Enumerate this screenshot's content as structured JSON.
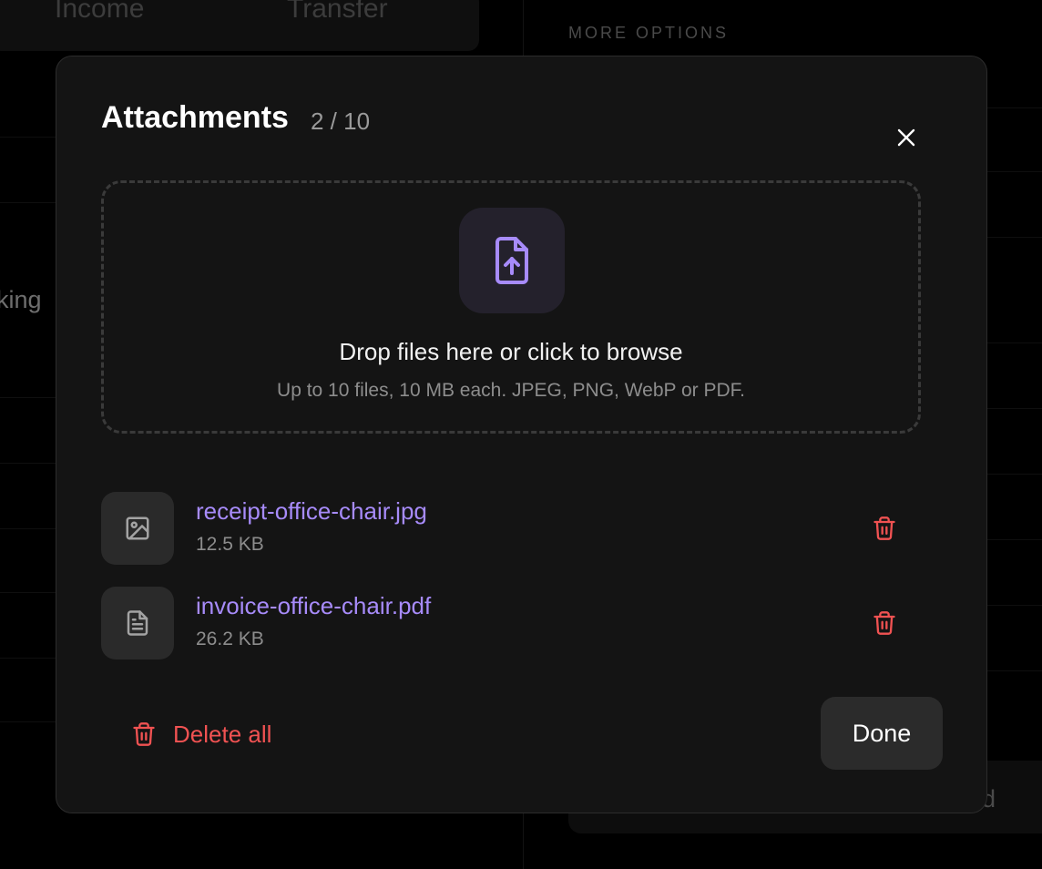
{
  "background": {
    "tabs": [
      "Income",
      "Transfer"
    ],
    "section_title": "MORE OPTIONS",
    "left_partial_text": "king",
    "bottom_partial_text": "d"
  },
  "modal": {
    "title": "Attachments",
    "count": "2 / 10",
    "close_icon": "close-icon",
    "dropzone": {
      "icon": "file-upload-icon",
      "title": "Drop files here or click to browse",
      "subtitle": "Up to 10 files, 10 MB each. JPEG, PNG, WebP or PDF."
    },
    "files": [
      {
        "name": "receipt-office-chair.jpg",
        "size": "12.5 KB",
        "icon": "image-icon"
      },
      {
        "name": "invoice-office-chair.pdf",
        "size": "26.2 KB",
        "icon": "document-icon"
      }
    ],
    "delete_all_label": "Delete all",
    "done_label": "Done"
  },
  "colors": {
    "accent": "#a78bfa",
    "danger": "#f05252",
    "modal_bg": "#141414",
    "page_bg": "#000000"
  }
}
